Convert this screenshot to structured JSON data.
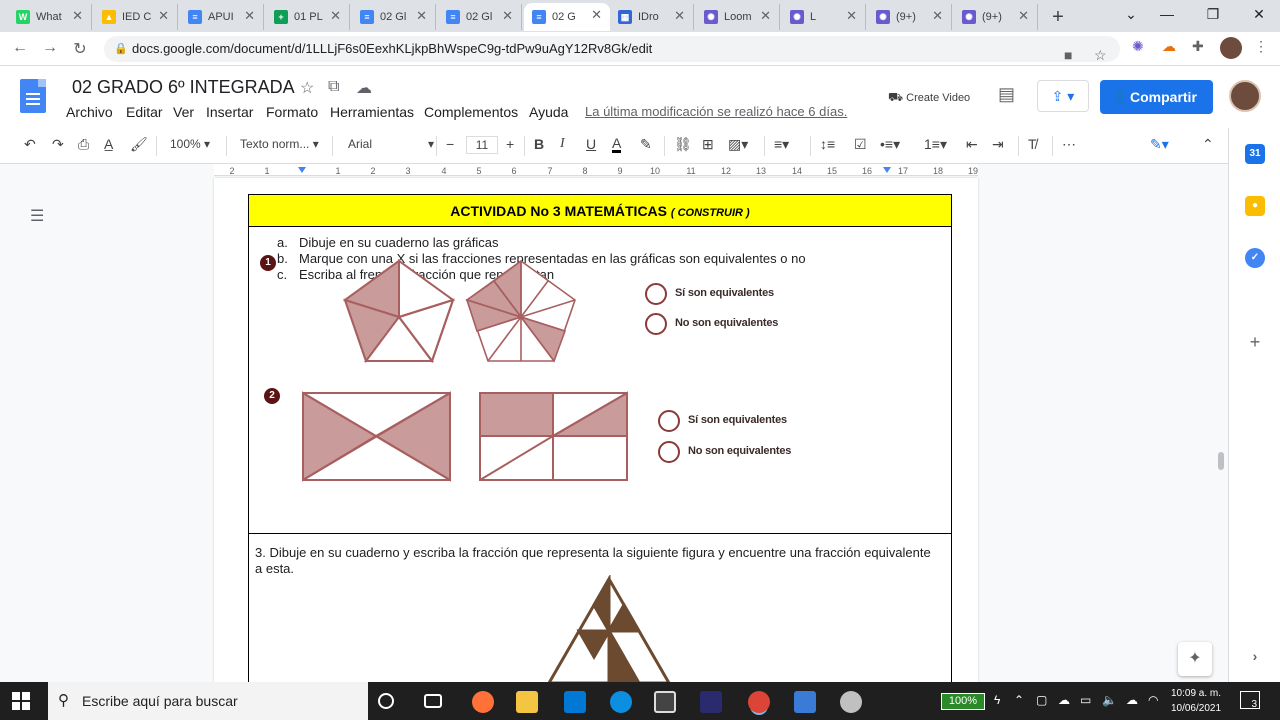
{
  "browser": {
    "tabs": [
      {
        "label": "What",
        "fav_color": "#25d366",
        "fav": "W"
      },
      {
        "label": "IED C",
        "fav_color": "#fbbc04",
        "fav": "▲"
      },
      {
        "label": "APUI",
        "fav_color": "#4285f4",
        "fav": "≡"
      },
      {
        "label": "01 PL",
        "fav_color": "#0f9d58",
        "fav": "+"
      },
      {
        "label": "02 Gl",
        "fav_color": "#4285f4",
        "fav": "≡"
      },
      {
        "label": "02 Gl",
        "fav_color": "#4285f4",
        "fav": "≡"
      },
      {
        "label": "02 G",
        "fav_color": "#4285f4",
        "fav": "≡"
      },
      {
        "label": "IDro",
        "fav_color": "#3367d6",
        "fav": "▦"
      },
      {
        "label": "Loom",
        "fav_color": "#6a5acd",
        "fav": "✺"
      },
      {
        "label": "L",
        "fav_color": "#6a5acd",
        "fav": "✺"
      },
      {
        "label": "(9+)",
        "fav_color": "#6a5acd",
        "fav": "✺"
      },
      {
        "label": "(9+)",
        "fav_color": "#6a5acd",
        "fav": "✺"
      }
    ],
    "active_tab_index": 6,
    "url": "docs.google.com/document/d/1LLLjF6s0EexhKLjkpBhWspeC9g-tdPw9uAgY12Rv8Gk/edit"
  },
  "docs": {
    "title": "02 GRADO 6º  INTEGRADA",
    "menus": [
      "Archivo",
      "Editar",
      "Ver",
      "Insertar",
      "Formato",
      "Herramientas",
      "Complementos",
      "Ayuda"
    ],
    "last_edit": "La última modificación se realizó hace 6 días.",
    "create_video": "Create Video",
    "share_label": "Compartir",
    "toolbar": {
      "zoom": "100%",
      "style": "Texto norm...",
      "font": "Arial",
      "font_size": "11"
    },
    "ruler_numbers": [
      "2",
      "1",
      "1",
      "2",
      "3",
      "4",
      "5",
      "6",
      "7",
      "8",
      "9",
      "10",
      "11",
      "12",
      "13",
      "14",
      "15",
      "16",
      "17",
      "18",
      "19"
    ]
  },
  "worksheet": {
    "header_title": "ACTIVIDAD No 3 MATEMÁTICAS",
    "header_note": "( CONSTRUIR )",
    "instructions": [
      {
        "label": "a.",
        "text": "Dibuje en su cuaderno las gráficas"
      },
      {
        "label": "b.",
        "text": "Marque con una  X  si las fracciones representadas en las gráficas son equivalentes o no"
      },
      {
        "label": "c.",
        "text": "Escriba al frente la fracción que representan"
      }
    ],
    "exercise1": {
      "number": "1",
      "yes": "Sí son equivalentes",
      "no": "No son equivalentes"
    },
    "exercise2": {
      "number": "2",
      "yes": "Sí son equivalentes",
      "no": "No son equivalentes"
    },
    "question3": "3. Dibuje en su cuaderno y escriba la fracción que representa la siguiente figura y encuentre una fracción equivalente a esta."
  },
  "taskbar": {
    "search_placeholder": "Escribe aquí para buscar",
    "battery": "100%",
    "time": "10:09 a. m.",
    "date": "10/06/2021",
    "notifications": "3"
  },
  "colors": {
    "fraction_fill": "#c99b9b",
    "fraction_stroke": "#a85f5f",
    "triangle_fill": "#6b4a30",
    "header_yellow": "#ffff00",
    "docs_blue": "#1a73e8"
  }
}
